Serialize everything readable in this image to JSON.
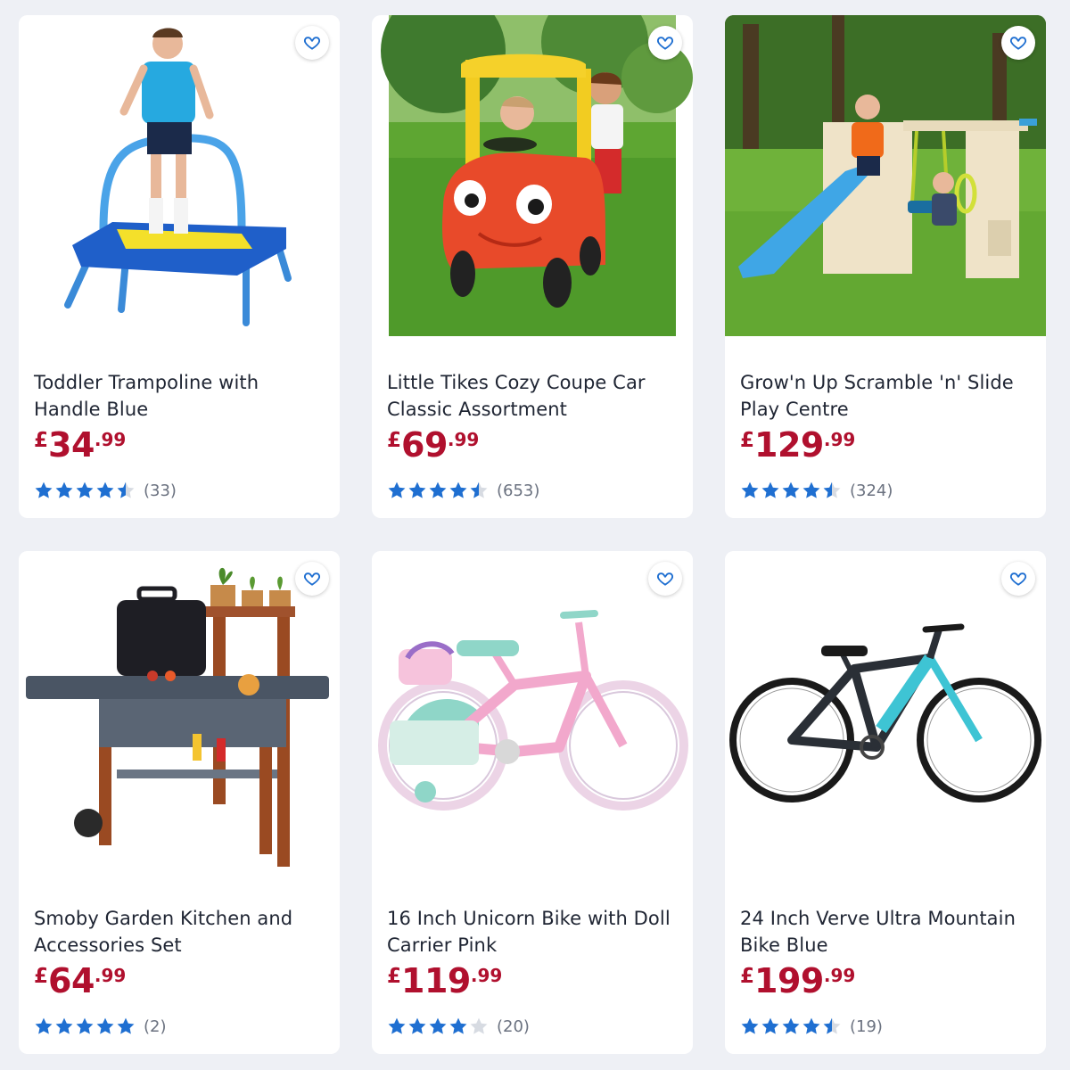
{
  "colors": {
    "star": "#1f6fd1",
    "star_empty": "#d7dbe2",
    "price": "#b0102e",
    "heart": "#1f6fd1"
  },
  "icons": {
    "wishlist": "heart-outline-icon",
    "rating_star": "star-icon"
  },
  "products": [
    {
      "title": "Toddler Trampoline with Handle Blue",
      "price": {
        "currency": "£",
        "main": "34",
        "decimals": ".99"
      },
      "rating": 4.5,
      "review_count": "(33)"
    },
    {
      "title": "Little Tikes Cozy Coupe Car Classic Assortment",
      "price": {
        "currency": "£",
        "main": "69",
        "decimals": ".99"
      },
      "rating": 4.5,
      "review_count": "(653)"
    },
    {
      "title": "Grow'n Up Scramble 'n' Slide Play Centre",
      "price": {
        "currency": "£",
        "main": "129",
        "decimals": ".99"
      },
      "rating": 4.5,
      "review_count": "(324)"
    },
    {
      "title": "Smoby Garden Kitchen and Accessories Set",
      "price": {
        "currency": "£",
        "main": "64",
        "decimals": ".99"
      },
      "rating": 5,
      "review_count": "(2)"
    },
    {
      "title": "16 Inch Unicorn Bike with Doll Carrier Pink",
      "price": {
        "currency": "£",
        "main": "119",
        "decimals": ".99"
      },
      "rating": 4,
      "review_count": "(20)"
    },
    {
      "title": "24 Inch Verve Ultra Mountain Bike Blue",
      "price": {
        "currency": "£",
        "main": "199",
        "decimals": ".99"
      },
      "rating": 4.5,
      "review_count": "(19)"
    }
  ]
}
